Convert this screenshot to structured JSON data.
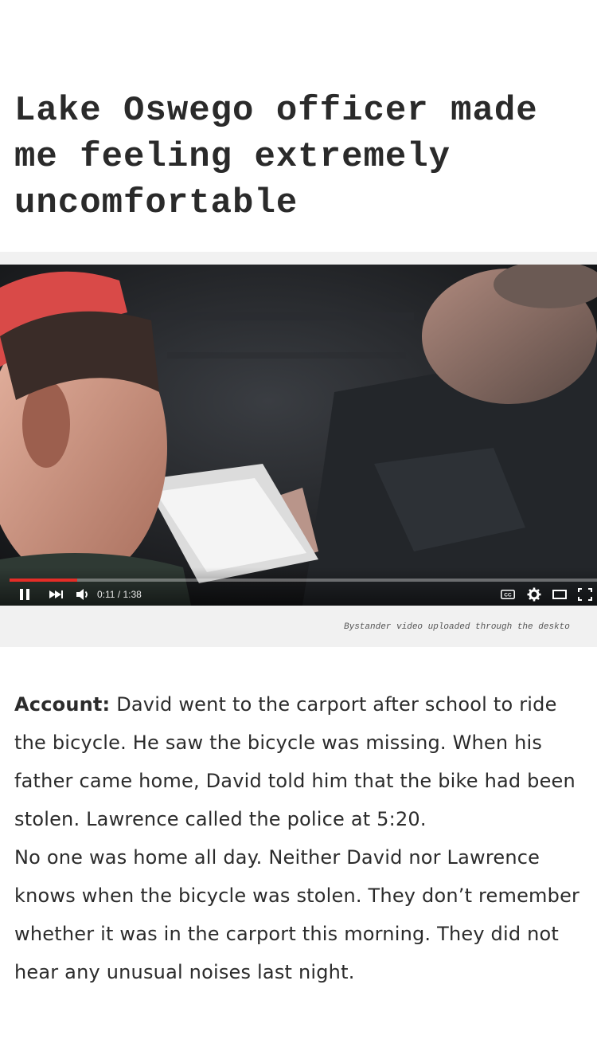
{
  "article": {
    "headline": "Lake Oswego officer made me feeling extremely uncomfortable"
  },
  "video": {
    "time_display": "0:11 / 1:38",
    "progress_fraction": 0.115,
    "accent_color": "#e52d27",
    "icons": [
      "pause-icon",
      "next-icon",
      "volume-icon",
      "cc-icon",
      "gear-icon",
      "theater-icon",
      "fullscreen-icon"
    ],
    "caption": "Bystander video uploaded through the deskto"
  },
  "account": {
    "label": "Account:",
    "paragraph1": "David went to the carport after school to ride the bicycle. He saw the bicycle was missing. When his father came home, David told him that the bike had been stolen. Lawrence called the police at 5:20.",
    "paragraph2": "No one was home all day. Neither David nor Lawrence knows when the bicycle was stolen. They don’t remember whether it was in the carport this morning. They did not hear any unusual noises last night."
  }
}
